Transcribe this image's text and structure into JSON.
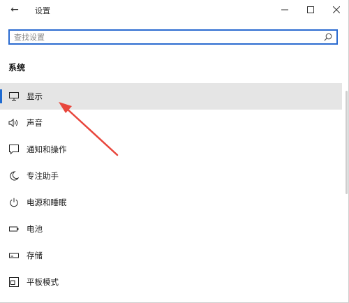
{
  "window": {
    "title": "设置",
    "back_glyph": "←"
  },
  "search": {
    "placeholder": "查找设置",
    "value": ""
  },
  "section": {
    "heading": "系统"
  },
  "nav": {
    "items": [
      {
        "label": "显示",
        "icon": "monitor-icon",
        "selected": true
      },
      {
        "label": "声音",
        "icon": "speaker-icon",
        "selected": false
      },
      {
        "label": "通知和操作",
        "icon": "notification-icon",
        "selected": false
      },
      {
        "label": "专注助手",
        "icon": "moon-icon",
        "selected": false
      },
      {
        "label": "电源和睡眠",
        "icon": "power-icon",
        "selected": false
      },
      {
        "label": "电池",
        "icon": "battery-icon",
        "selected": false
      },
      {
        "label": "存储",
        "icon": "storage-icon",
        "selected": false
      },
      {
        "label": "平板模式",
        "icon": "tablet-icon",
        "selected": false
      }
    ]
  },
  "colors": {
    "accent": "#1f6bd1",
    "search_border": "#2b6bd0",
    "selected_bg": "#e5e5e5",
    "annotation_arrow": "#e8463c"
  }
}
